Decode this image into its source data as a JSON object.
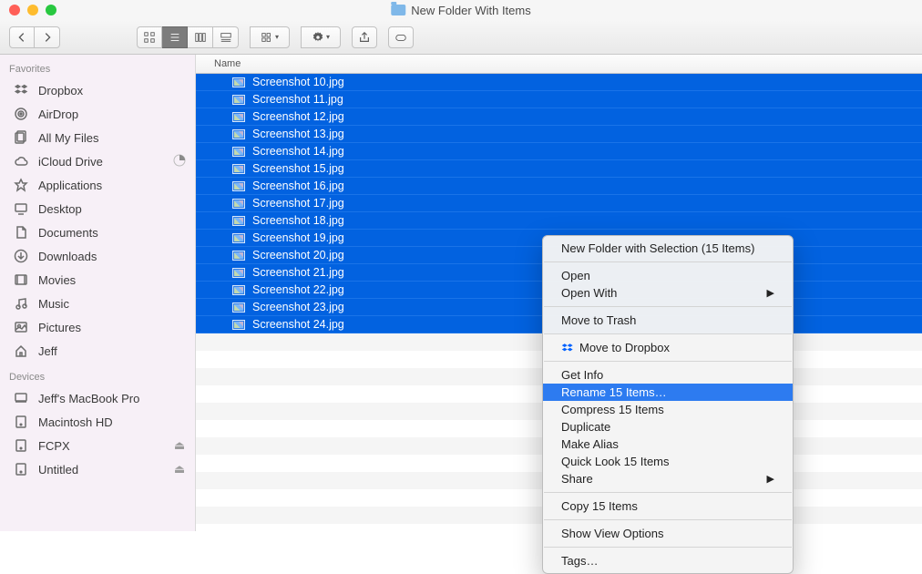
{
  "window": {
    "title": "New Folder With Items"
  },
  "cols": {
    "name": "Name"
  },
  "sidebar": {
    "favorites_label": "Favorites",
    "devices_label": "Devices",
    "favorites": [
      {
        "label": "Dropbox",
        "icon": "dropbox-icon",
        "eject": false
      },
      {
        "label": "AirDrop",
        "icon": "airdrop-icon",
        "eject": false
      },
      {
        "label": "All My Files",
        "icon": "allfiles-icon",
        "eject": false
      },
      {
        "label": "iCloud Drive",
        "icon": "cloud-icon",
        "eject": false,
        "progress": true
      },
      {
        "label": "Applications",
        "icon": "applications-icon",
        "eject": false
      },
      {
        "label": "Desktop",
        "icon": "desktop-icon",
        "eject": false
      },
      {
        "label": "Documents",
        "icon": "documents-icon",
        "eject": false
      },
      {
        "label": "Downloads",
        "icon": "downloads-icon",
        "eject": false
      },
      {
        "label": "Movies",
        "icon": "movies-icon",
        "eject": false
      },
      {
        "label": "Music",
        "icon": "music-icon",
        "eject": false
      },
      {
        "label": "Pictures",
        "icon": "pictures-icon",
        "eject": false
      },
      {
        "label": "Jeff",
        "icon": "home-icon",
        "eject": false
      }
    ],
    "devices": [
      {
        "label": "Jeff's MacBook Pro",
        "icon": "computer-icon",
        "eject": false
      },
      {
        "label": "Macintosh HD",
        "icon": "disk-icon",
        "eject": false
      },
      {
        "label": "FCPX",
        "icon": "disk-icon",
        "eject": true
      },
      {
        "label": "Untitled",
        "icon": "disk-icon",
        "eject": true
      }
    ]
  },
  "files": [
    {
      "name": "Screenshot 10.jpg"
    },
    {
      "name": "Screenshot 11.jpg"
    },
    {
      "name": "Screenshot 12.jpg"
    },
    {
      "name": "Screenshot 13.jpg"
    },
    {
      "name": "Screenshot 14.jpg"
    },
    {
      "name": "Screenshot 15.jpg"
    },
    {
      "name": "Screenshot 16.jpg"
    },
    {
      "name": "Screenshot 17.jpg"
    },
    {
      "name": "Screenshot 18.jpg"
    },
    {
      "name": "Screenshot 19.jpg"
    },
    {
      "name": "Screenshot 20.jpg"
    },
    {
      "name": "Screenshot 21.jpg"
    },
    {
      "name": "Screenshot 22.jpg"
    },
    {
      "name": "Screenshot 23.jpg"
    },
    {
      "name": "Screenshot 24.jpg"
    }
  ],
  "context_menu": {
    "groups": [
      [
        {
          "label": "New Folder with Selection (15 Items)",
          "submenu": false,
          "highlight": false
        }
      ],
      [
        {
          "label": "Open",
          "submenu": false,
          "highlight": false
        },
        {
          "label": "Open With",
          "submenu": true,
          "highlight": false
        }
      ],
      [
        {
          "label": "Move to Trash",
          "submenu": false,
          "highlight": false
        }
      ],
      [
        {
          "label": "Move to Dropbox",
          "submenu": false,
          "highlight": false,
          "icon": "dropbox-icon"
        }
      ],
      [
        {
          "label": "Get Info",
          "submenu": false,
          "highlight": false
        },
        {
          "label": "Rename 15 Items…",
          "submenu": false,
          "highlight": true
        },
        {
          "label": "Compress 15 Items",
          "submenu": false,
          "highlight": false
        },
        {
          "label": "Duplicate",
          "submenu": false,
          "highlight": false
        },
        {
          "label": "Make Alias",
          "submenu": false,
          "highlight": false
        },
        {
          "label": "Quick Look 15 Items",
          "submenu": false,
          "highlight": false
        },
        {
          "label": "Share",
          "submenu": true,
          "highlight": false
        }
      ],
      [
        {
          "label": "Copy 15 Items",
          "submenu": false,
          "highlight": false
        }
      ],
      [
        {
          "label": "Show View Options",
          "submenu": false,
          "highlight": false
        }
      ],
      [
        {
          "label": "Tags…",
          "submenu": false,
          "highlight": false
        }
      ]
    ]
  }
}
